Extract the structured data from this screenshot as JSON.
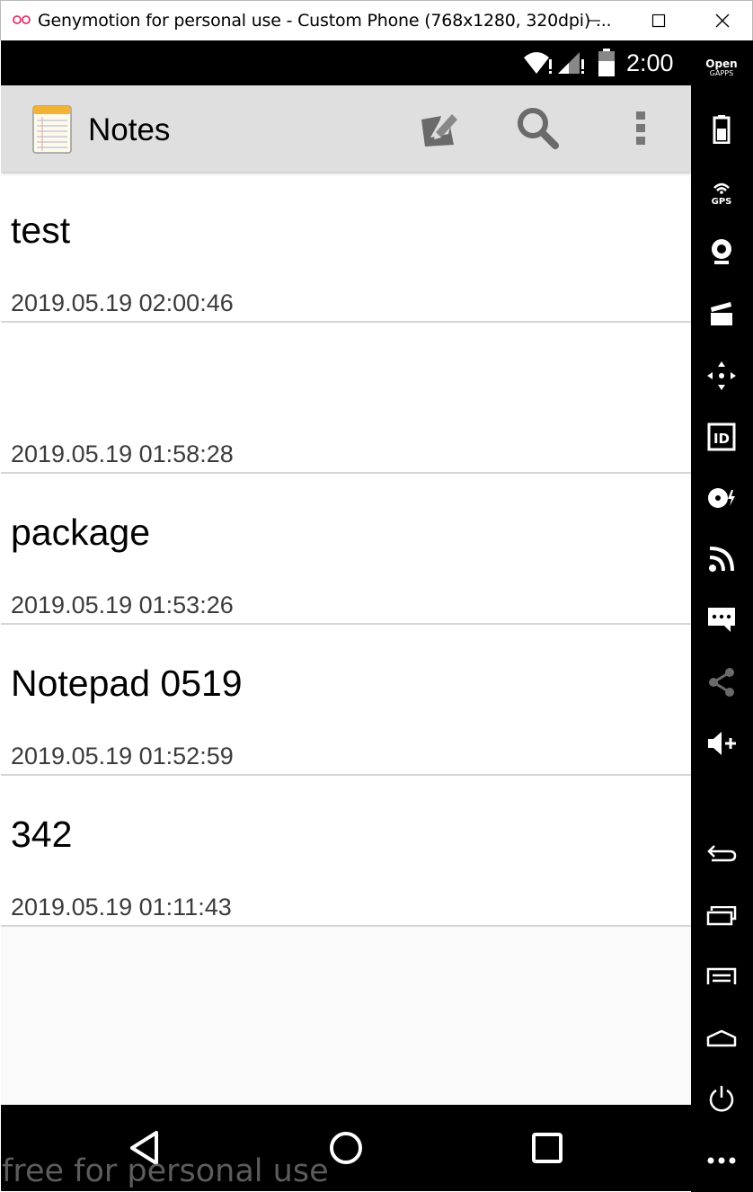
{
  "window": {
    "title": "Genymotion for personal use - Custom Phone (768x1280, 320dpi) ...",
    "controls": [
      "minimize-icon",
      "maximize-icon",
      "close-icon"
    ]
  },
  "status_bar": {
    "time": "2:00",
    "icons": [
      "wifi-alert-icon",
      "signal-alert-icon",
      "battery-icon"
    ]
  },
  "action_bar": {
    "title": "Notes",
    "icons": [
      "notepad-app-icon",
      "new-note-icon",
      "search-icon",
      "overflow-menu-icon"
    ]
  },
  "notes": [
    {
      "title": "test",
      "date": "2019.05.19 02:00:46"
    },
    {
      "title": "",
      "date": "2019.05.19 01:58:28"
    },
    {
      "title": "package",
      "date": "2019.05.19 01:53:26"
    },
    {
      "title": "Notepad 0519",
      "date": "2019.05.19 01:52:59"
    },
    {
      "title": "342",
      "date": "2019.05.19 01:11:43"
    }
  ],
  "nav_bar": {
    "icons": [
      "back-triangle-icon",
      "home-circle-icon",
      "recents-square-icon"
    ]
  },
  "watermark": "free for personal use",
  "sidebar": {
    "open_gapps_line1": "Open",
    "open_gapps_line2": "GAPPS",
    "gps_label": "GPS",
    "id_label": "ID",
    "icons": [
      "battery-icon",
      "gps-icon",
      "webcam-icon",
      "clapperboard-icon",
      "dpad-icon",
      "id-icon",
      "disk-icon",
      "cast-icon",
      "sms-icon",
      "share-icon",
      "volume-up-icon",
      "back-icon",
      "recent-apps-icon",
      "menu-icon",
      "home-icon",
      "power-icon",
      "more-icon"
    ]
  },
  "colors": {
    "action_bar_bg": "#dfdfdf",
    "divider": "#d6d6d6",
    "logo_pink": "#e8336e"
  }
}
